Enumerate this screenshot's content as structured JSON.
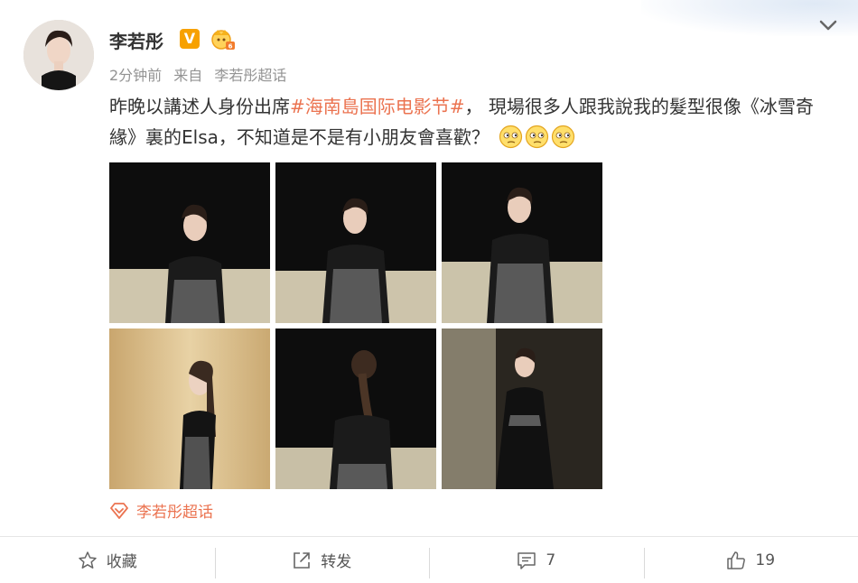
{
  "post": {
    "author": "李若彤",
    "verified_badge": "V",
    "time": "2分钟前",
    "source_prefix": "来自",
    "source": "李若彤超话",
    "text_part1": "昨晚以講述人身份出席",
    "topic": "#海南島国际电影节#",
    "text_part2": "， 現場很多人跟我說我的髮型很像《冰雪奇緣》裏的Elsa，不知道是不是有小朋友會喜歡？",
    "emoji_name": "thinking-face-icon",
    "supertopic_label": "李若彤超话"
  },
  "actions": {
    "favorite": "收藏",
    "repost": "转发",
    "comment_count": "7",
    "like_count": "19"
  },
  "colors": {
    "topic": "#eb7350",
    "badge": "#f7a100",
    "meta": "#939393"
  }
}
